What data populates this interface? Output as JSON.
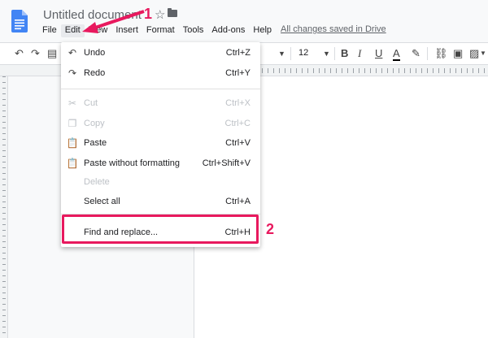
{
  "app": {
    "doc_title": "Untitled document",
    "star_icon": "star-icon",
    "folder_icon": "folder-icon"
  },
  "menubar": {
    "items": [
      "File",
      "Edit",
      "View",
      "Insert",
      "Format",
      "Tools",
      "Add-ons",
      "Help"
    ],
    "active": "Edit",
    "saved_status": "All changes saved in Drive"
  },
  "toolbar": {
    "font_size": "12"
  },
  "edit_menu": {
    "items": [
      {
        "icon": "undo-icon",
        "label": "Undo",
        "shortcut": "Ctrl+Z",
        "enabled": true
      },
      {
        "icon": "redo-icon",
        "label": "Redo",
        "shortcut": "Ctrl+Y",
        "enabled": true
      },
      {
        "icon": "cut-icon",
        "label": "Cut",
        "shortcut": "Ctrl+X",
        "enabled": false
      },
      {
        "icon": "copy-icon",
        "label": "Copy",
        "shortcut": "Ctrl+C",
        "enabled": false
      },
      {
        "icon": "paste-icon",
        "label": "Paste",
        "shortcut": "Ctrl+V",
        "enabled": true
      },
      {
        "icon": "paste-plain-icon",
        "label": "Paste without formatting",
        "shortcut": "Ctrl+Shift+V",
        "enabled": true
      },
      {
        "icon": "",
        "label": "Delete",
        "shortcut": "",
        "enabled": false
      },
      {
        "icon": "",
        "label": "Select all",
        "shortcut": "Ctrl+A",
        "enabled": true
      },
      {
        "icon": "",
        "label": "Find and replace...",
        "shortcut": "Ctrl+H",
        "enabled": true
      }
    ]
  },
  "annotations": {
    "step1": "1",
    "step2": "2",
    "accent_color": "#e8195e"
  }
}
